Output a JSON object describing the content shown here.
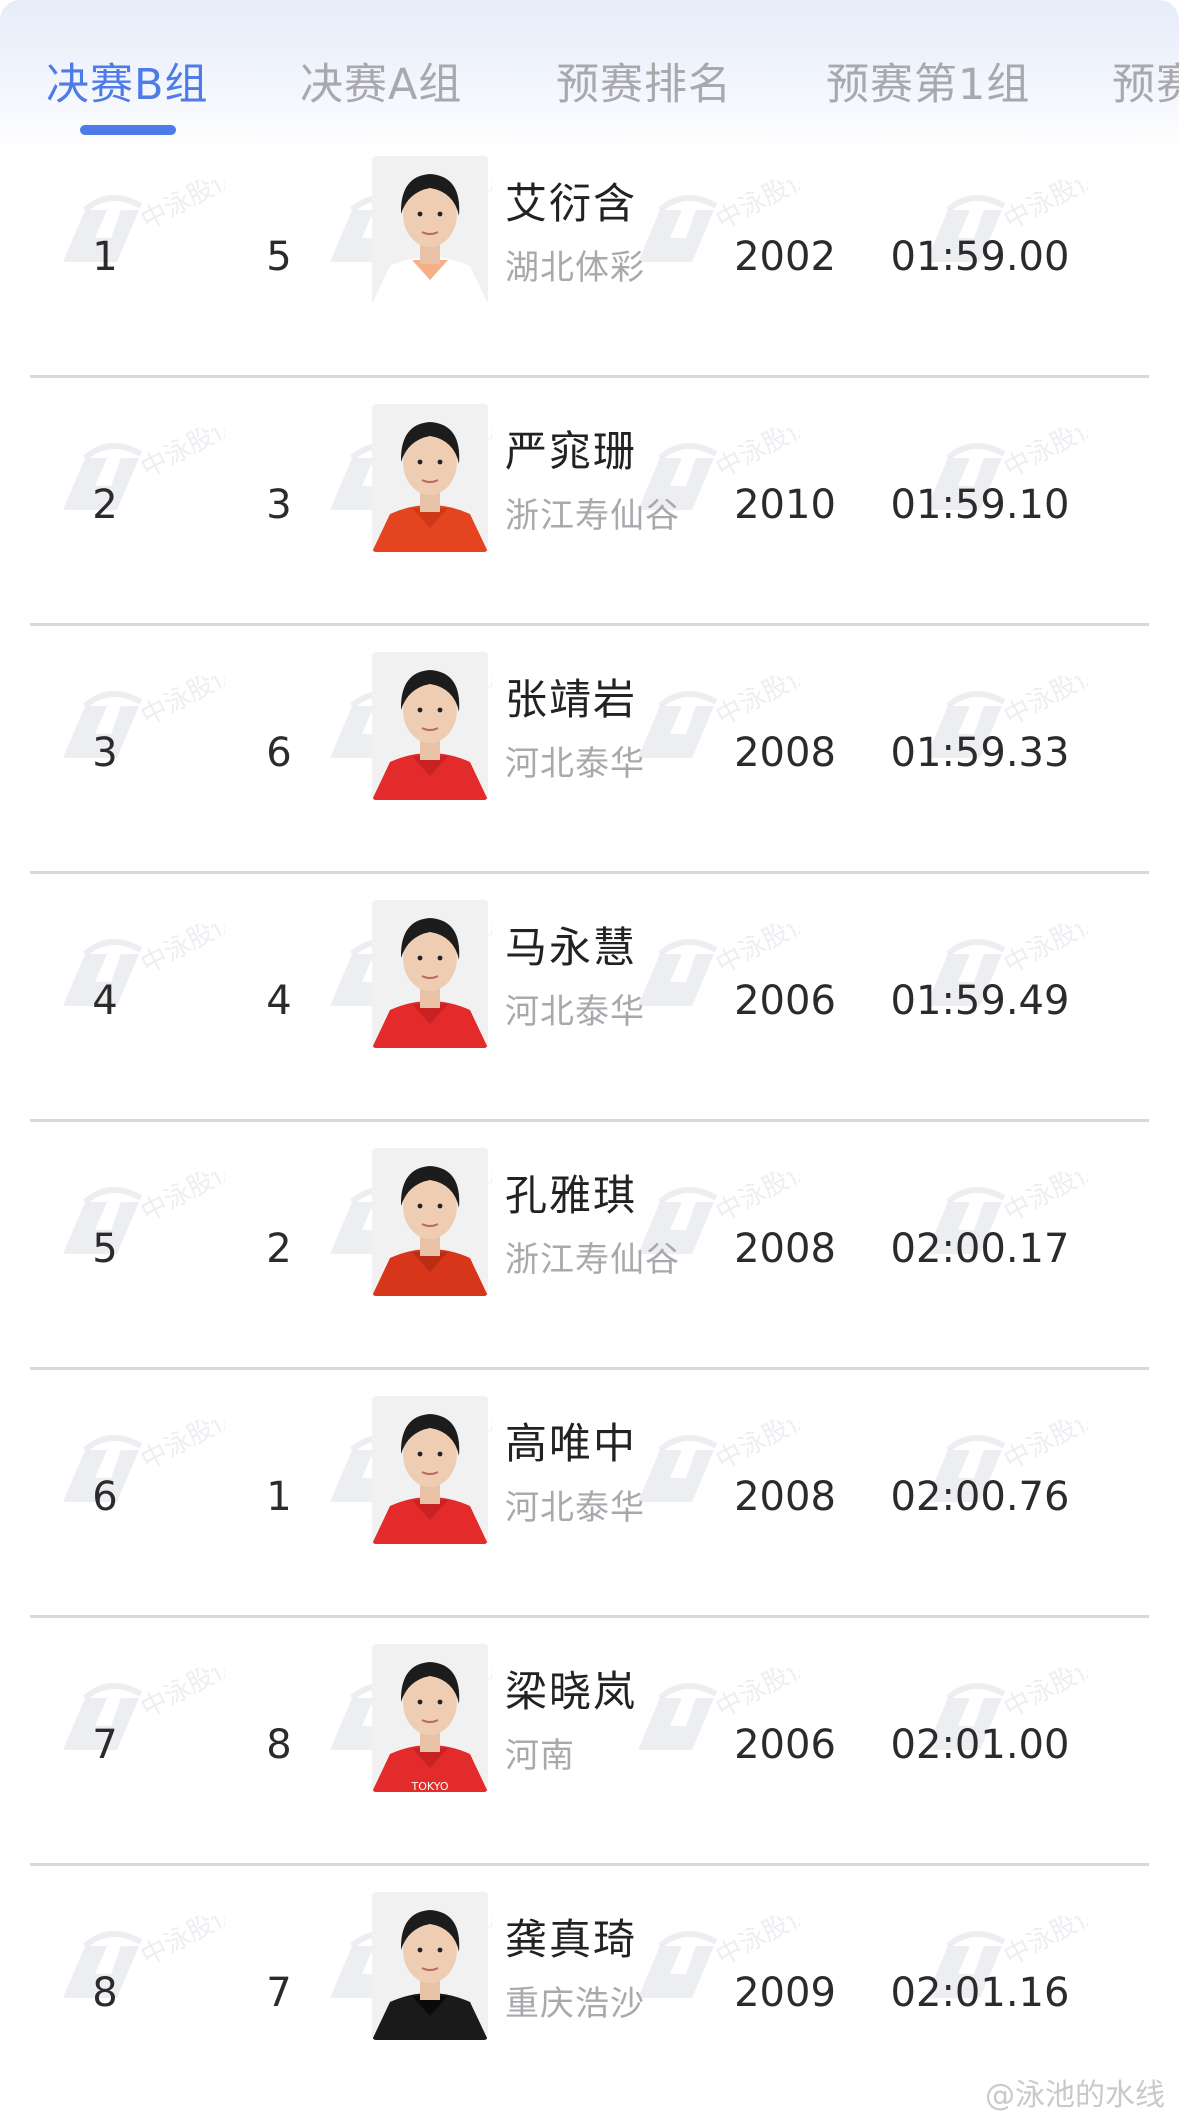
{
  "tabs": [
    {
      "label": "决赛B组",
      "active": true
    },
    {
      "label": "决赛A组",
      "active": false
    },
    {
      "label": "预赛排名",
      "active": false
    },
    {
      "label": "预赛第1组",
      "active": false
    },
    {
      "label": "预赛",
      "active": false
    }
  ],
  "rows": [
    {
      "rank": "1",
      "lane": "5",
      "name": "艾衍含",
      "team": "湖北体彩",
      "year": "2002",
      "time": "01:59.00",
      "shirt": "#ffffff",
      "accent": "#f07a3a"
    },
    {
      "rank": "2",
      "lane": "3",
      "name": "严窕珊",
      "team": "浙江寿仙谷",
      "year": "2010",
      "time": "01:59.10",
      "shirt": "#e4441f",
      "accent": "#c23013"
    },
    {
      "rank": "3",
      "lane": "6",
      "name": "张靖岩",
      "team": "河北泰华",
      "year": "2008",
      "time": "01:59.33",
      "shirt": "#e32b2b",
      "accent": "#b81c1c"
    },
    {
      "rank": "4",
      "lane": "4",
      "name": "马永慧",
      "team": "河北泰华",
      "year": "2006",
      "time": "01:59.49",
      "shirt": "#e32b2b",
      "accent": "#b81c1c"
    },
    {
      "rank": "5",
      "lane": "2",
      "name": "孔雅琪",
      "team": "浙江寿仙谷",
      "year": "2008",
      "time": "02:00.17",
      "shirt": "#d7361b",
      "accent": "#a92610"
    },
    {
      "rank": "6",
      "lane": "1",
      "name": "高唯中",
      "team": "河北泰华",
      "year": "2008",
      "time": "02:00.76",
      "shirt": "#e32b2b",
      "accent": "#b81c1c"
    },
    {
      "rank": "7",
      "lane": "8",
      "name": "梁晓岚",
      "team": "河南",
      "year": "2006",
      "time": "02:01.00",
      "shirt": "#e32b2b",
      "accent": "#b81c1c",
      "shirt_text": "TOKYO"
    },
    {
      "rank": "8",
      "lane": "7",
      "name": "龚真琦",
      "team": "重庆浩沙",
      "year": "2009",
      "time": "02:01.16",
      "shirt": "#1a1a1a",
      "accent": "#000000"
    }
  ],
  "watermark": {
    "text": "中泳股份"
  },
  "credit": "@泳池的水线",
  "colors": {
    "accent": "#4d7ce8",
    "text": "#2b2b2b",
    "muted": "#a9a9ad",
    "divider": "#d9d9dd"
  }
}
